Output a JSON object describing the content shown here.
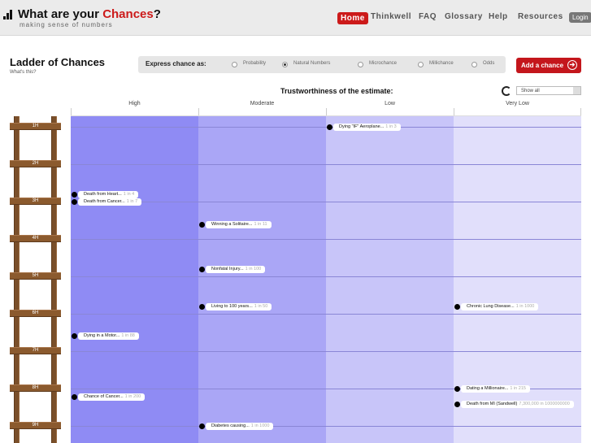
{
  "header": {
    "title_prefix": "What are your ",
    "title_accent": "Chances",
    "title_suffix": "?",
    "tagline": "making sense of numbers",
    "nav": [
      "Home",
      "Thinkwell",
      "FAQ",
      "Glossary",
      "Help",
      "Resources"
    ],
    "login": "Login"
  },
  "page": {
    "title": "Ladder of Chances",
    "whats_this": "What's this?",
    "express_label": "Express chance as:",
    "options": [
      "Probability",
      "Natural Numbers",
      "Microchance",
      "Millichance",
      "Odds"
    ],
    "selected_option": "Natural Numbers",
    "add_button": "Add a chance",
    "trust_title": "Trustworthiness of the estimate:",
    "filter_value": "Show all"
  },
  "columns": [
    "High",
    "Moderate",
    "Low",
    "Very Low"
  ],
  "column_colors": [
    "#8f8bf4",
    "#aaa6f6",
    "#c8c5f9",
    "#e1dffb"
  ],
  "rungs": [
    "1H",
    "2H",
    "3H",
    "4H",
    "5H",
    "6H",
    "7H",
    "8H",
    "9H"
  ],
  "chances": [
    {
      "label": "Dying \"IF\" Aeroplane...",
      "value": "1 in 3"
    },
    {
      "label": "Death from Heart...",
      "value": "1 in 4"
    },
    {
      "label": "Death from Cancer...",
      "value": "1 in 7"
    },
    {
      "label": "Winning a Solitaire...",
      "value": "1 in 11"
    },
    {
      "label": "Nonfatal Injury...",
      "value": "1 in 100"
    },
    {
      "label": "Living to 100 years...",
      "value": "1 in 50"
    },
    {
      "label": "Chronic Lung Disease...",
      "value": "1 in 1000"
    },
    {
      "label": "Dying in a Motor...",
      "value": "1 in 88"
    },
    {
      "label": "Chance of Cancer...",
      "value": "1 in 200"
    },
    {
      "label": "Dating a Millionaire...",
      "value": "1 in 215"
    },
    {
      "label": "Death from MI (Sandwell)",
      "value": "7,300,000 in 1000000000"
    },
    {
      "label": "Diabetes causing...",
      "value": "1 in 1000"
    }
  ]
}
